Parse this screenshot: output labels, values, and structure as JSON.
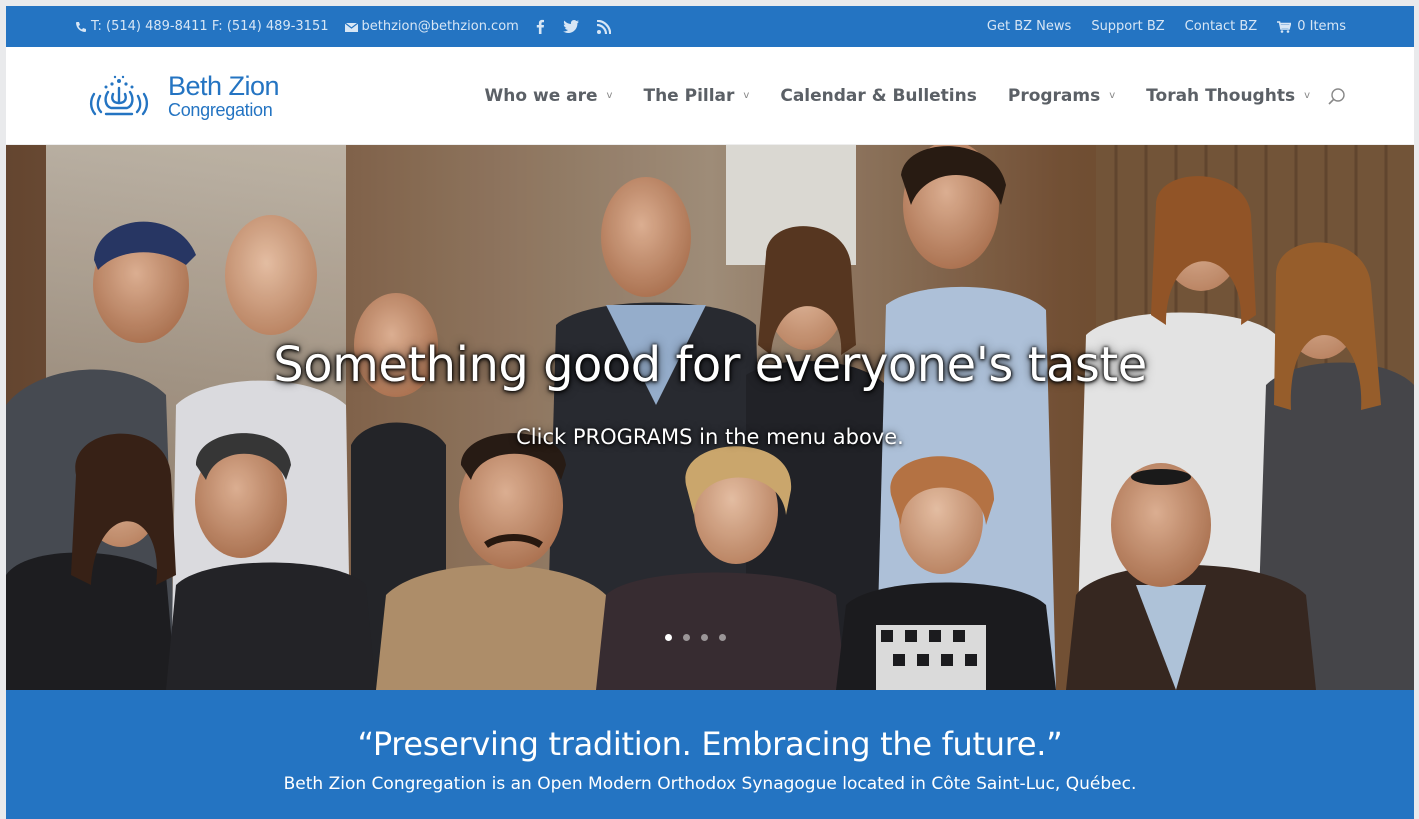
{
  "topbar": {
    "phone": "T: (514) 489-8411 F: (514) 489-3151",
    "email": "bethzion@bethzion.com",
    "social_icons": [
      "facebook-icon",
      "twitter-icon",
      "rss-icon"
    ],
    "links": [
      "Get BZ News",
      "Support BZ",
      "Contact BZ"
    ],
    "cart": "0 Items"
  },
  "header": {
    "logo_title": "Beth Zion",
    "logo_subtitle": "Congregation",
    "nav": [
      {
        "label": "Who we are",
        "dropdown": true
      },
      {
        "label": "The Pillar",
        "dropdown": true
      },
      {
        "label": "Calendar & Bulletins",
        "dropdown": false
      },
      {
        "label": "Programs",
        "dropdown": true
      },
      {
        "label": "Torah Thoughts",
        "dropdown": true
      }
    ],
    "chevron": "v"
  },
  "hero": {
    "title": "Something good for everyone's taste",
    "subtitle": "Click PROGRAMS in the menu above.",
    "slides": 4,
    "active_slide": 1
  },
  "tagline": {
    "quote": "“Preserving tradition. Embracing the future.”",
    "description": "Beth Zion Congregation is an Open Modern Orthodox Synagogue located in Côte Saint-Luc, Québec."
  },
  "colors": {
    "brand_blue": "#2474c2",
    "nav_text": "#5b6066"
  }
}
